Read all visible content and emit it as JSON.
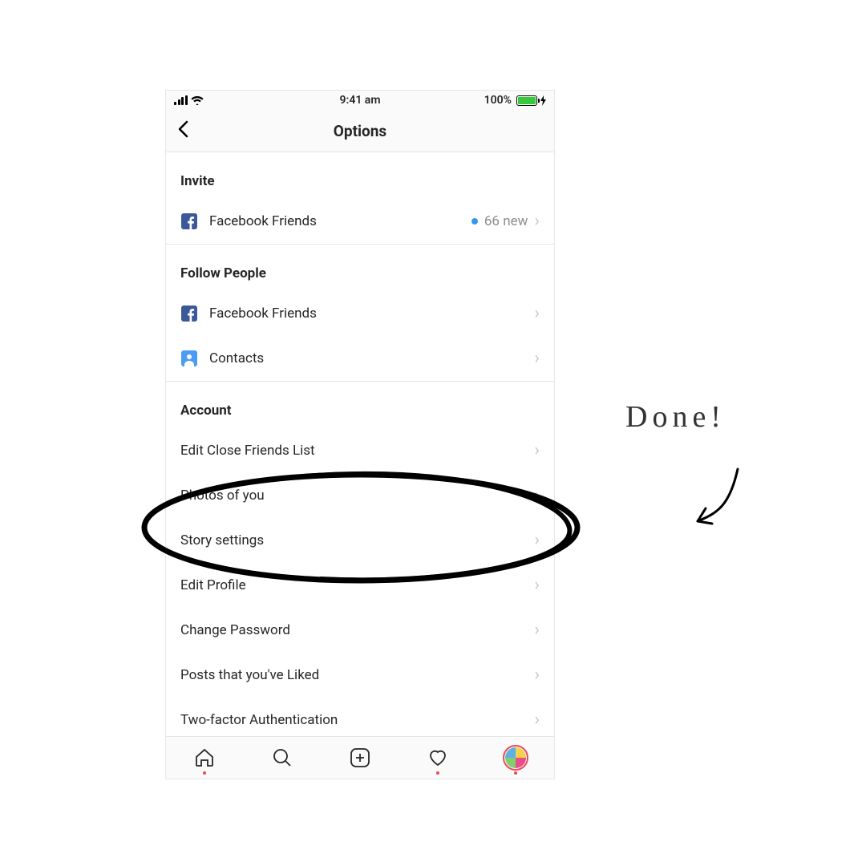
{
  "status": {
    "time": "9:41 am",
    "battery_text": "100%"
  },
  "nav": {
    "title": "Options"
  },
  "sections": {
    "invite_header": "Invite",
    "invite_row_label": "Facebook Friends",
    "invite_badge": "66 new",
    "follow_header": "Follow People",
    "follow_facebook": "Facebook Friends",
    "follow_contacts": "Contacts",
    "account_header": "Account",
    "account_items": {
      "edit_close_friends": "Edit Close Friends List",
      "photos_of_you": "Photos of you",
      "story_settings": "Story settings",
      "edit_profile": "Edit Profile",
      "change_password": "Change Password",
      "posts_liked": "Posts that you've Liked",
      "two_factor": "Two-factor Authentication"
    }
  },
  "annotation": {
    "done": "Done!"
  }
}
